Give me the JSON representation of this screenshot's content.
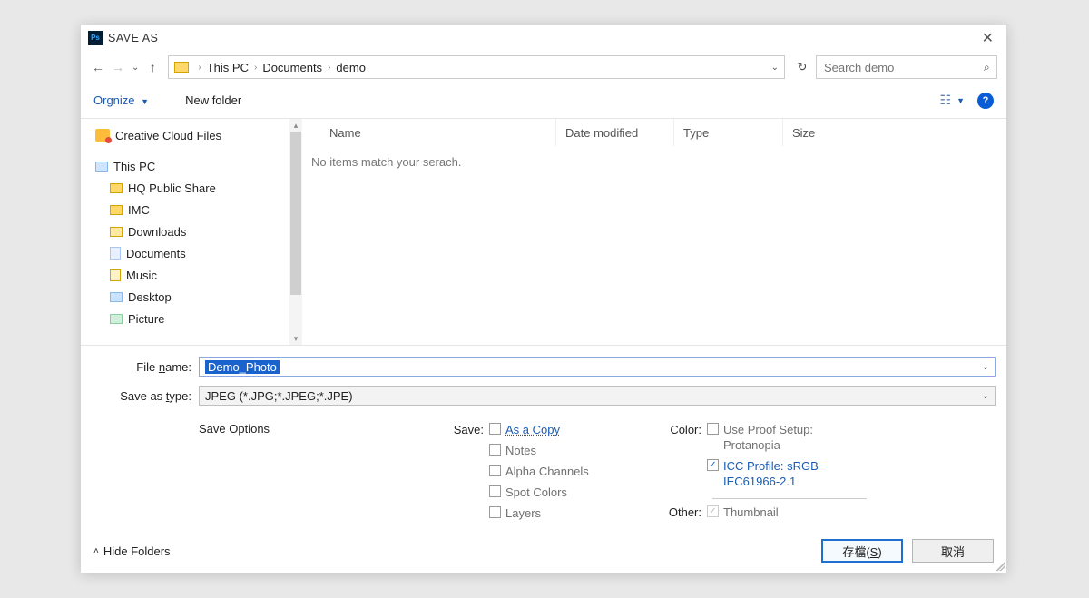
{
  "window": {
    "title": "SAVE AS",
    "app_icon_text": "Ps"
  },
  "breadcrumb": {
    "items": [
      "This PC",
      "Documents",
      "demo"
    ]
  },
  "search": {
    "placeholder": "Search demo"
  },
  "toolbar": {
    "organize": "Orgnize",
    "new_folder": "New folder"
  },
  "sidebar": {
    "items": [
      {
        "label": "Creative Cloud Files",
        "icon": "cloud-icon",
        "level": 0
      },
      {
        "label": "This PC",
        "icon": "pc-icon",
        "level": 0
      },
      {
        "label": "HQ Public Share",
        "icon": "folder-icon",
        "level": 1
      },
      {
        "label": "IMC",
        "icon": "folder-icon",
        "level": 1
      },
      {
        "label": "Downloads",
        "icon": "downloads-icon",
        "level": 1
      },
      {
        "label": "Documents",
        "icon": "doc-icon",
        "level": 1
      },
      {
        "label": "Music",
        "icon": "music-icon",
        "level": 1
      },
      {
        "label": "Desktop",
        "icon": "desktop-icon",
        "level": 1
      },
      {
        "label": "Picture",
        "icon": "picture-icon",
        "level": 1
      }
    ]
  },
  "columns": {
    "name": "Name",
    "date": "Date modified",
    "type": "Type",
    "size": "Size"
  },
  "empty_message": "No items match your serach.",
  "fields": {
    "file_name_label_pre": "File ",
    "file_name_label_ul": "n",
    "file_name_label_post": "ame:",
    "file_name_value": "Demo_Photo",
    "save_type_label_pre": "Save as ",
    "save_type_label_ul": "t",
    "save_type_label_post": "ype:",
    "save_type_value": "JPEG (*.JPG;*.JPEG;*.JPE)"
  },
  "options": {
    "heading": "Save Options",
    "save_label": "Save:",
    "as_a_copy": "As a Copy",
    "notes": "Notes",
    "alpha": "Alpha Channels",
    "spot": "Spot Colors",
    "layers": "Layers",
    "color_label": "Color:",
    "use_proof": "Use Proof Setup: Protanopia",
    "icc_profile": "ICC Profile:  sRGB IEC61966-2.1",
    "other_label": "Other:",
    "thumbnail": "Thumbnail"
  },
  "footer": {
    "hide_folders": "Hide Folders",
    "save_button": "存檔(S)",
    "cancel_button": "取消"
  }
}
